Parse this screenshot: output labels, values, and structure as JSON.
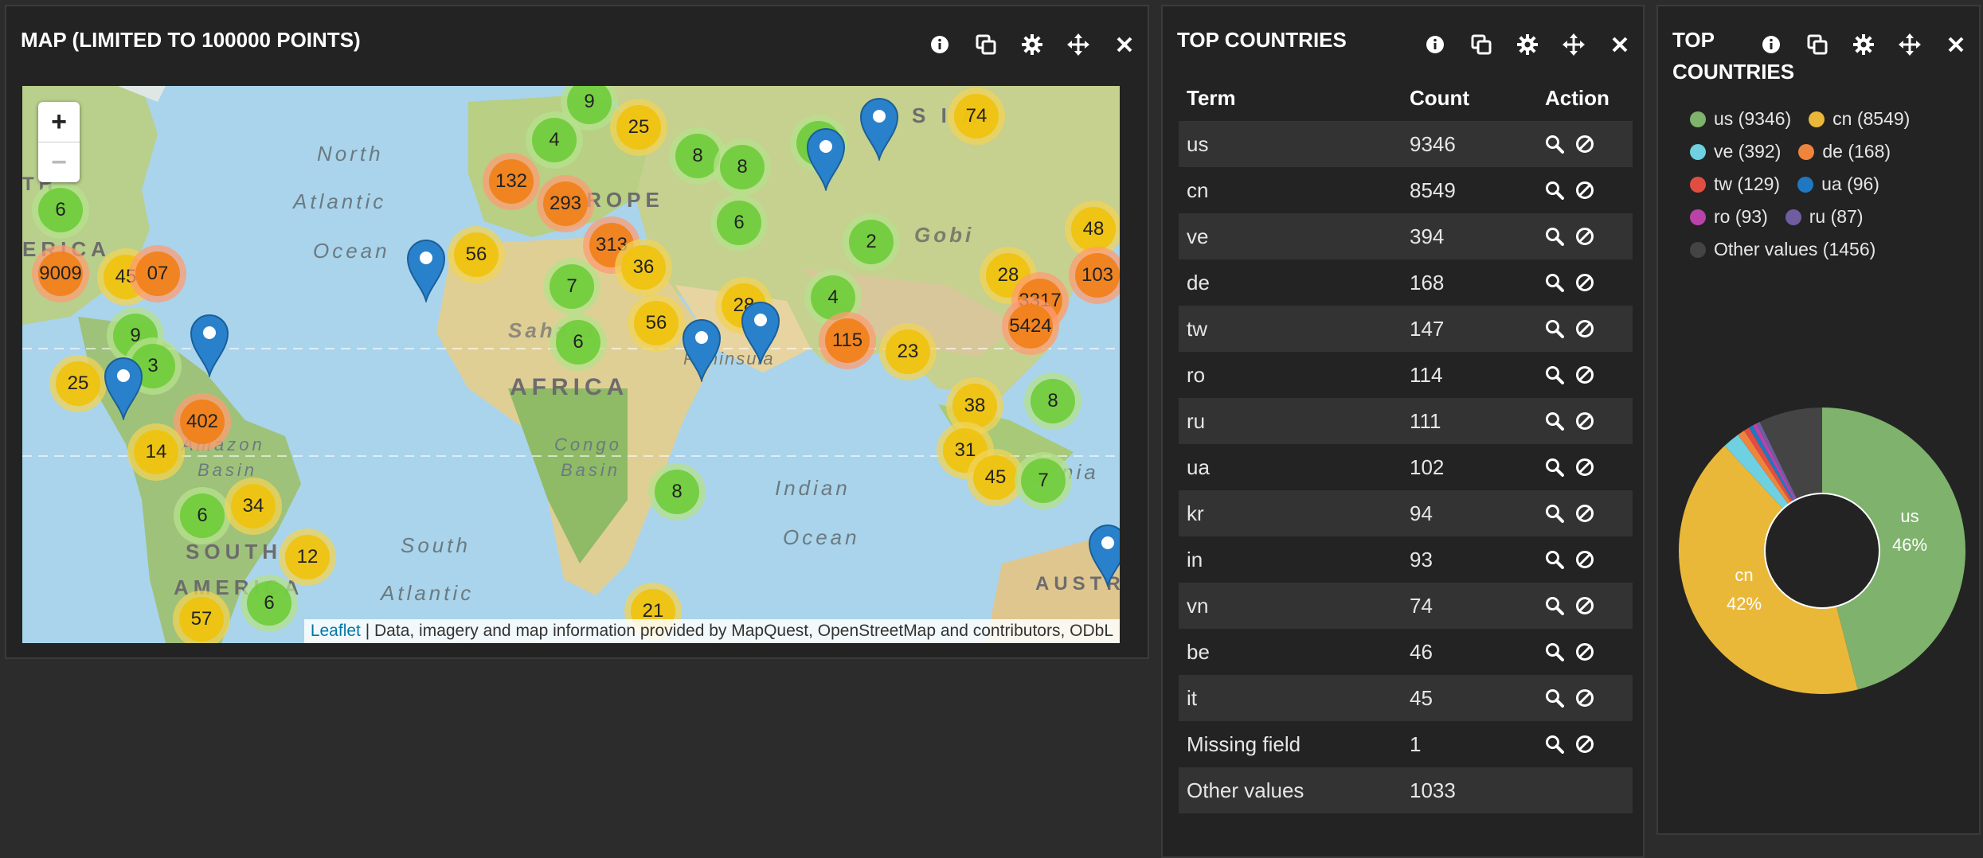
{
  "map_panel": {
    "title": "MAP (LIMITED TO 100000 POINTS)",
    "zoom_in": "+",
    "zoom_out": "−",
    "attribution_link": "Leaflet",
    "attribution_text": " | Data, imagery and map information provided by MapQuest, OpenStreetMap and contributors, ODbL",
    "labels": {
      "north": "North",
      "atlantic": "Atlantic",
      "ocean": "Ocean",
      "europe": "EUROPE",
      "gobi": "Gobi",
      "sahara": "Sahara",
      "africa": "AFRICA",
      "peninsula": "Peninsula",
      "congo": "Congo",
      "basin": "Basin",
      "indian": "Indian",
      "ocean2": "Ocean",
      "amazon": "Amazon",
      "basin2": "Basin",
      "south": "SOUTH",
      "america": "AMERICA",
      "south2": "South",
      "atlantic2": "Atlantic",
      "austr": "AUSTR",
      "rica": "ERICA",
      "th": "TH",
      "asia": "A S I A",
      "nia": "nia"
    },
    "clusters": [
      "9",
      "4",
      "25",
      "74",
      "132",
      "293",
      "8",
      "8",
      "6",
      "6",
      "6",
      "9009",
      "45",
      "07",
      "56",
      "313",
      "36",
      "2",
      "48",
      "28",
      "3317",
      "103",
      "7",
      "5424",
      "4",
      "6",
      "56",
      "28",
      "115",
      "23",
      "9",
      "3",
      "25",
      "402",
      "38",
      "8",
      "14",
      "31",
      "45",
      "7",
      "6",
      "34",
      "12",
      "8",
      "6",
      "21",
      "57"
    ]
  },
  "table_panel": {
    "title": "TOP COUNTRIES",
    "columns": [
      "Term",
      "Count",
      "Action"
    ],
    "rows": [
      {
        "term": "us",
        "count": "9346"
      },
      {
        "term": "cn",
        "count": "8549"
      },
      {
        "term": "ve",
        "count": "394"
      },
      {
        "term": "de",
        "count": "168"
      },
      {
        "term": "tw",
        "count": "147"
      },
      {
        "term": "ro",
        "count": "114"
      },
      {
        "term": "ru",
        "count": "111"
      },
      {
        "term": "ua",
        "count": "102"
      },
      {
        "term": "kr",
        "count": "94"
      },
      {
        "term": "in",
        "count": "93"
      },
      {
        "term": "vn",
        "count": "74"
      },
      {
        "term": "be",
        "count": "46"
      },
      {
        "term": "it",
        "count": "45"
      },
      {
        "term": "Missing field",
        "count": "1"
      },
      {
        "term": "Other values",
        "count": "1033"
      }
    ]
  },
  "pie_panel": {
    "title": "TOP COUNTRIES",
    "legend": [
      {
        "label": "us (9346)",
        "color": "#7eb26d"
      },
      {
        "label": "cn (8549)",
        "color": "#eab839"
      },
      {
        "label": "ve (392)",
        "color": "#6ed0e0"
      },
      {
        "label": "de (168)",
        "color": "#ef843c"
      },
      {
        "label": "tw (129)",
        "color": "#e24d42"
      },
      {
        "label": "ua (96)",
        "color": "#1f78c1"
      },
      {
        "label": "ro (93)",
        "color": "#ba43a9"
      },
      {
        "label": "ru (87)",
        "color": "#705da0"
      },
      {
        "label": "Other values (1456)",
        "color": "#444444"
      }
    ],
    "slice_labels": {
      "us": "us",
      "us_pct": "46%",
      "cn": "cn",
      "cn_pct": "42%"
    }
  },
  "chart_data": {
    "type": "pie",
    "title": "TOP COUNTRIES",
    "donut": true,
    "categories": [
      "us",
      "cn",
      "ve",
      "de",
      "tw",
      "ua",
      "ro",
      "ru",
      "Other values"
    ],
    "values": [
      9346,
      8549,
      392,
      168,
      129,
      96,
      93,
      87,
      1456
    ],
    "labels_shown": {
      "us": "46%",
      "cn": "42%"
    }
  },
  "colors": {
    "panel_bg": "#232323",
    "page_bg": "#2c2c2c",
    "accent_blue": "#1f78c1"
  }
}
